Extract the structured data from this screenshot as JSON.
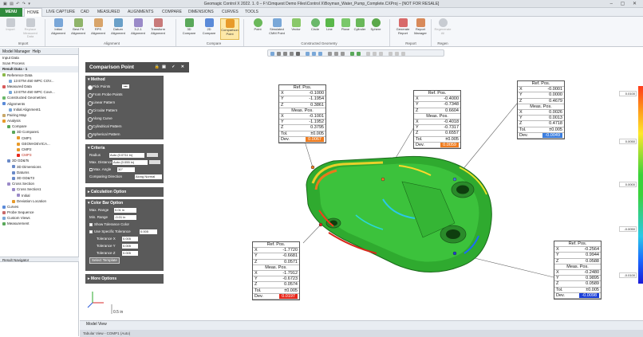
{
  "window": {
    "title": "Geomagic Control X 2022. 1. 0 – F:\\Cimquest Demo Files\\Control X\\Boyman_Water_Pump_Complete.CXProj – [NOT FOR RESALE]"
  },
  "menu": {
    "main_label": "MENU",
    "tabs": [
      "HOME",
      "LIVE CAPTURE",
      "CAD",
      "MEASURED",
      "ALIGNMENTS",
      "COMPARE",
      "DIMENSIONS",
      "CURVES",
      "TOOLS"
    ],
    "active": "HOME"
  },
  "ribbon": {
    "groups": [
      {
        "label": "Import",
        "buttons": [
          "Import",
          "Replace\nMeasured Data"
        ]
      },
      {
        "label": "Alignment",
        "buttons": [
          "Initial\nAlignment",
          "Best Fit\nAlignment",
          "RPS\nAlignment",
          "Datum\nAlignment",
          "3-2-1\nAlignment",
          "Transform\nAlignment"
        ]
      },
      {
        "label": "Compare",
        "buttons": [
          "3D\nCompare",
          "2D\nCompare",
          "Comparison\nPoint"
        ]
      },
      {
        "label": "Constructed Geometry",
        "buttons": [
          "Point",
          "Simulated\nCMM Point",
          "Vector",
          "Circle",
          "Line",
          "Plane",
          "Cylinder",
          "Sphere"
        ]
      },
      {
        "label": "Report",
        "buttons": [
          "Generate\nReport",
          "Report\nManager"
        ]
      },
      {
        "label": "Regen",
        "buttons": [
          "Regenerate\nAll"
        ]
      }
    ]
  },
  "left_panel": {
    "tabs": [
      "Model Manager",
      "Help"
    ],
    "sections": [
      "Input Data",
      "Scan Process",
      "Result Data - 1"
    ],
    "tree": [
      "Reference Data",
      "13 ETM 450 WPC COV...",
      "Measured Data",
      "13 ETM 450 WPC Cove...",
      "Constructed Geometries",
      "Alignments",
      "Initial Alignment1",
      "Pairing Map",
      "Analysis",
      "Compare",
      "3D Compare1",
      "CMP1",
      "GEOM-DEVICA...",
      "CMP2",
      "CMP3",
      "3D GD&Ts",
      "3D Dimensions",
      "Datums",
      "3D GD&T3",
      "Cross Section",
      "Cross Section1",
      "Initial",
      "Deviation Location",
      "Curves",
      "Probe Sequence",
      "Custom Views",
      "Measurement"
    ],
    "result_navigator": "Result Navigator"
  },
  "comparison_panel": {
    "title": "Comparison Point",
    "method": {
      "header": "Method",
      "options": [
        "Pick Points",
        "From Probe Points",
        "Linear Pattern",
        "Circular Pattern",
        "Along Curve",
        "Cylindrical Pattern",
        "Spherical Pattern"
      ],
      "selected": "Pick Points"
    },
    "criteria": {
      "header": "Criteria",
      "radius_label": "Radius",
      "radius_value": "Auto (0.0711 in)",
      "max_distance_label": "Max. Distance",
      "max_distance_value": "Auto (0.055 in)",
      "max_angle_label": "Max. Angle",
      "max_angle_value": "30°",
      "comparing_direction_label": "Comparing Direction",
      "comparing_direction_value": "Along Normal"
    },
    "calculation": "Calculation Option",
    "color_bar": {
      "header": "Color Bar Option",
      "max_range_label": "Max. Range",
      "max_range_value": "0.01 in",
      "min_range_label": "Min. Range",
      "min_range_value": "-0.01 in",
      "show_tolerance": "Show Tolerance Color",
      "use_specific": "Use Specific Tolerance",
      "use_specific_value": "0.005",
      "tol_x_label": "Tolerance X",
      "tol_x": "0.005",
      "tol_y_label": "Tolerance Y",
      "tol_y": "0.005",
      "tol_z_label": "Tolerance Z",
      "tol_z": "0.005",
      "select_template": "Select Template"
    },
    "more_options": "More Options"
  },
  "callouts": [
    {
      "ref": [
        "-0.1000",
        "-1.1954",
        "0.3861"
      ],
      "meas": [
        "-0.1001",
        "-1.1952",
        "0.3795"
      ],
      "tol": "±0.005",
      "dev": "0.0067",
      "dev_color": "#f07c1e"
    },
    {
      "ref": [
        "-0.4000",
        "-0.7348",
        "0.6604"
      ],
      "meas": [
        "-0.4018",
        "-0.7317",
        "0.6557"
      ],
      "tol": "±0.005",
      "dev": "0.0059",
      "dev_color": "#f07c1e"
    },
    {
      "ref": [
        "-0.0001",
        "0.0000",
        "0.4679"
      ],
      "meas": [
        "0.0026",
        "0.0013",
        "0.4718"
      ],
      "tol": "±0.005",
      "dev": "-0.0049",
      "dev_color": "#3c7fe0"
    },
    {
      "ref": [
        "-1.7720",
        "-0.6681",
        "0.0571"
      ],
      "meas": [
        "-1.7912",
        "-0.6723",
        "0.0574"
      ],
      "tol": "±0.005",
      "dev": "0.0197",
      "dev_color": "#e8281c"
    },
    {
      "ref": [
        "-0.2564",
        "0.9944",
        "0.0588"
      ],
      "meas": [
        "-0.2480",
        "0.9895",
        "0.0589"
      ],
      "tol": "±0.005",
      "dev": "-0.0098",
      "dev_color": "#1a3fd8"
    }
  ],
  "callout_labels": {
    "ref": "Ref. Pos.",
    "meas": "Meas. Pos.",
    "x": "X",
    "y": "Y",
    "z": "Z",
    "tol": "Tol.",
    "dev": "Dev."
  },
  "legend": {
    "values": [
      "0.0100",
      "0.0050",
      "0.0000",
      "-0.0050",
      "-0.0100"
    ]
  },
  "scale": "0.5 in",
  "status": {
    "model_view": "Model View",
    "tabular_view": "Tabular View - COMP1 (Auto)"
  }
}
